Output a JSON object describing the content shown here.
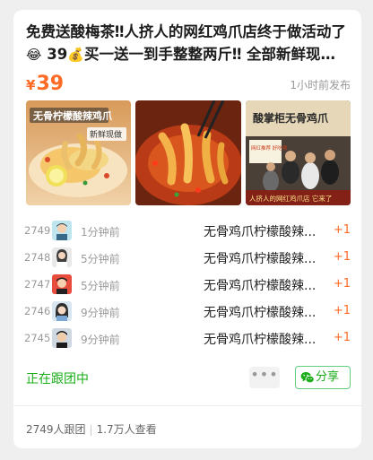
{
  "post": {
    "title_part1": "免费送酸梅茶‼人挤人的网红鸡爪店终于做活动了",
    "title_emoji1": "😂",
    "title_part2": "39",
    "title_emoji2": "💰",
    "title_part3": "买一送一到手整整两斤‼ 全部新鲜现…",
    "currency": "¥",
    "price": "39",
    "posted_time": "1小时前发布",
    "image_text": {
      "img1_banner": "无骨柠檬酸辣鸡爪",
      "img1_badge": "新鲜现做",
      "img3_sign": "酸掌柜无骨鸡爪",
      "img3_side": "网红推荐 好吃嗦",
      "img3_caption": "人挤人的网红鸡爪店 它来了"
    }
  },
  "records": [
    {
      "num": "2749",
      "time": "1分钟前",
      "item": "无骨鸡爪柠檬酸辣...",
      "qty": "+1",
      "avatar": "avatar-boy-cartoon"
    },
    {
      "num": "2748",
      "time": "5分钟前",
      "item": "无骨鸡爪柠檬酸辣...",
      "qty": "+1",
      "avatar": "avatar-girl-photo"
    },
    {
      "num": "2747",
      "time": "5分钟前",
      "item": "无骨鸡爪柠檬酸辣...",
      "qty": "+1",
      "avatar": "avatar-red-cartoon"
    },
    {
      "num": "2746",
      "time": "9分钟前",
      "item": "无骨鸡爪柠檬酸辣...",
      "qty": "+1",
      "avatar": "avatar-girl-cartoon"
    },
    {
      "num": "2745",
      "time": "9分钟前",
      "item": "无骨鸡爪柠檬酸辣...",
      "qty": "+1",
      "avatar": "avatar-boy-dark"
    }
  ],
  "actions": {
    "following_label": "正在跟团中",
    "more_label": "•••",
    "share_label": "分享"
  },
  "stats": {
    "joined": "2749人跟团",
    "views": "1.7万人查看"
  },
  "colors": {
    "price": "#ff6a25",
    "green": "#1aad19",
    "qty": "#ff6a25"
  }
}
